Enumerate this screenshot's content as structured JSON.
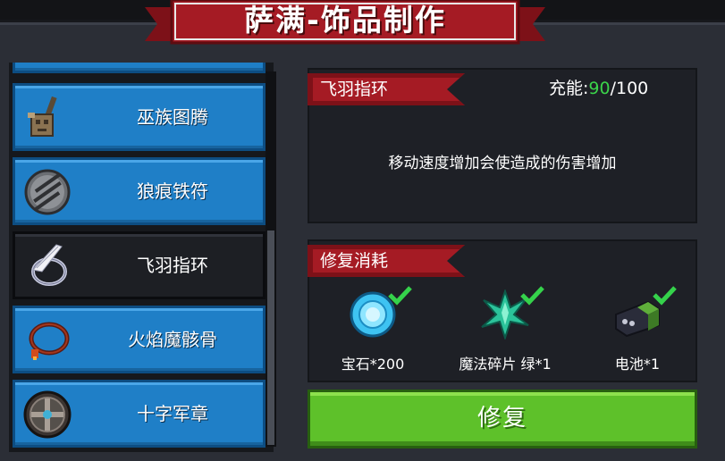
{
  "header": {
    "title": "萨满-饰品制作"
  },
  "accessories": [
    {
      "name": "",
      "icon": "partial-item-icon"
    },
    {
      "name": "巫族图腾",
      "icon": "totem-icon"
    },
    {
      "name": "狼痕铁符",
      "icon": "claw-charm-icon"
    },
    {
      "name": "飞羽指环",
      "icon": "feather-ring-icon",
      "selected": true
    },
    {
      "name": "火焰魔骸骨",
      "icon": "bone-necklace-icon"
    },
    {
      "name": "十字军章",
      "icon": "crusader-badge-icon"
    }
  ],
  "detail": {
    "name": "飞羽指环",
    "charge_label": "充能:",
    "charge_current": "90",
    "charge_sep": "/",
    "charge_max": "100",
    "description": "移动速度增加会使造成的伤害增加"
  },
  "repair_cost": {
    "title": "修复消耗",
    "materials": [
      {
        "label": "宝石*200",
        "icon": "gem-icon",
        "fulfilled": true
      },
      {
        "label": "魔法碎片 绿*1",
        "icon": "green-magic-shard-icon",
        "fulfilled": true
      },
      {
        "label": "电池*1",
        "icon": "battery-icon",
        "fulfilled": true
      }
    ]
  },
  "actions": {
    "repair_label": "修复"
  },
  "colors": {
    "accent_red": "#a51b24",
    "item_blue": "#1f7fc7",
    "button_green": "#5ec12a",
    "charge_green": "#3bd44a"
  }
}
